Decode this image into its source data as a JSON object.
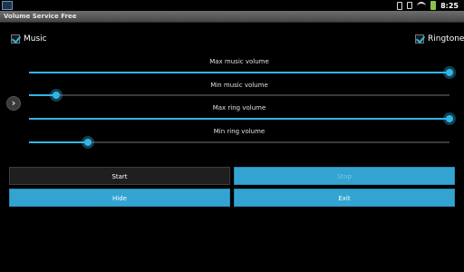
{
  "status_bar": {
    "time": "8:25",
    "icons": [
      "app-notification-icon",
      "usb-icon",
      "sd-card-icon",
      "wifi-icon",
      "battery-icon"
    ]
  },
  "title_bar": {
    "title": "Volume Service Free"
  },
  "checkboxes": {
    "music": {
      "label": "Music",
      "checked": true
    },
    "ringtone": {
      "label": "Ringtone",
      "checked": true
    }
  },
  "sliders": {
    "max_music": {
      "label": "Max music volume",
      "value": 1.0
    },
    "min_music": {
      "label": "Min music volume",
      "value": 0.065
    },
    "max_ring": {
      "label": "Max ring volume",
      "value": 1.0
    },
    "min_ring": {
      "label": "Min ring volume",
      "value": 0.14
    }
  },
  "nav": {
    "arrow_icon": "chevron-right-icon"
  },
  "buttons": {
    "start": "Start",
    "stop": "Stop",
    "hide": "Hide",
    "exit": "Exit"
  },
  "colors": {
    "accent": "#33b5e5",
    "button_blue": "#33a4d2",
    "background": "#000000"
  }
}
